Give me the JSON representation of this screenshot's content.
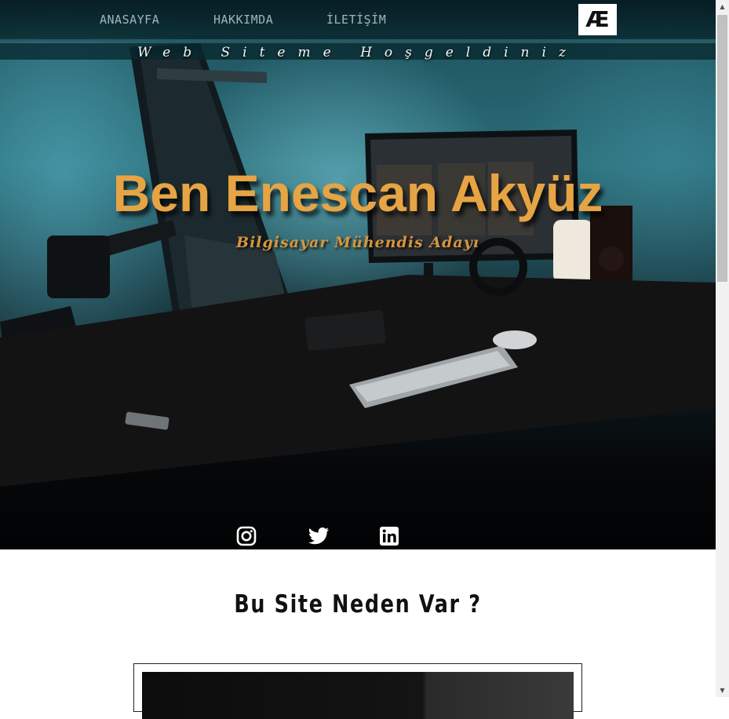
{
  "nav": {
    "items": [
      {
        "label": "ANASAYFA"
      },
      {
        "label": "HAKKIMDA"
      },
      {
        "label": "İLETİŞİM"
      }
    ],
    "logo_text": "Æ"
  },
  "hero": {
    "welcome": "Web Siteme Hoşgeldiniz",
    "title": "Ben Enescan Akyüz",
    "subtitle": "Bilgisayar Mühendis Adayı",
    "title_color": "#e6a444",
    "subtitle_color": "#d7953e"
  },
  "social": [
    {
      "icon": "instagram-icon"
    },
    {
      "icon": "twitter-icon"
    },
    {
      "icon": "linkedin-icon"
    }
  ],
  "section": {
    "title": "Bu Site Neden Var ?"
  },
  "scrollbar": {
    "up_arrow": "▲",
    "down_arrow": "▼"
  }
}
